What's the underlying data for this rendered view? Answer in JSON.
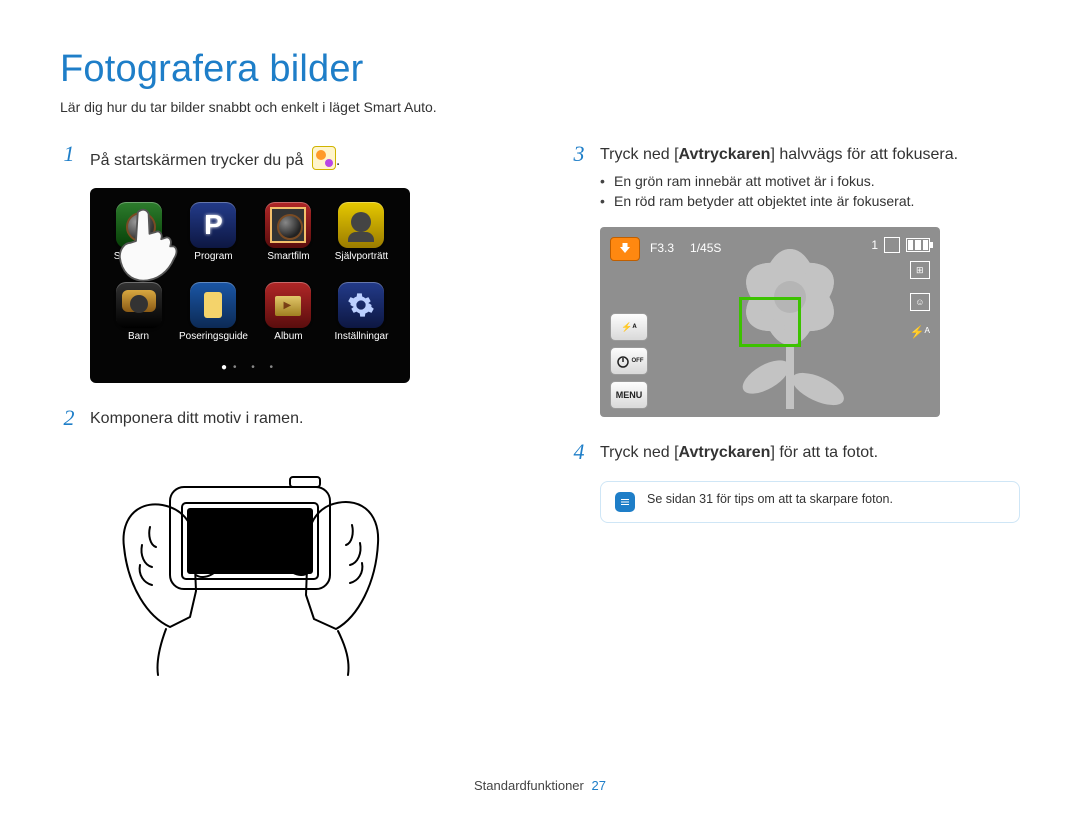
{
  "title": "Fotografera bilder",
  "subtitle": "Lär dig hur du tar bilder snabbt och enkelt i läget Smart Auto.",
  "steps": {
    "s1": {
      "num": "1",
      "text": "På startskärmen trycker du på"
    },
    "s2": {
      "num": "2",
      "text": "Komponera ditt motiv i ramen."
    },
    "s3": {
      "num": "3",
      "pre": "Tryck ned [",
      "strong": "Avtryckaren",
      "post": "] halvvägs för att fokusera."
    },
    "s4": {
      "num": "4",
      "pre": "Tryck ned [",
      "strong": "Avtryckaren",
      "post": "] för att ta fotot."
    }
  },
  "home": {
    "items": [
      {
        "key": "smartauto",
        "label": "Smart Auto"
      },
      {
        "key": "program",
        "label": "Program"
      },
      {
        "key": "smartfilm",
        "label": "Smartfilm"
      },
      {
        "key": "self",
        "label": "Självporträtt"
      },
      {
        "key": "child",
        "label": "Barn"
      },
      {
        "key": "pose",
        "label": "Poseringsguide"
      },
      {
        "key": "album",
        "label": "Album"
      },
      {
        "key": "settings",
        "label": "Inställningar"
      }
    ]
  },
  "bullets": {
    "b1": "En grön ram innebär att motivet är i fokus.",
    "b2": "En röd ram betyder att objektet inte är fokuserat."
  },
  "preview": {
    "aperture": "F3.3",
    "shutter": "1/45S",
    "count": "1",
    "btn_flash": "⚡ᴬ",
    "btn_timer": "OFF",
    "btn_menu": "MENU",
    "right_flash": "⚡ᴬ"
  },
  "tip": "Se sidan 31 för tips om att ta skarpare foton.",
  "footer": {
    "section": "Standardfunktioner",
    "page": "27"
  }
}
